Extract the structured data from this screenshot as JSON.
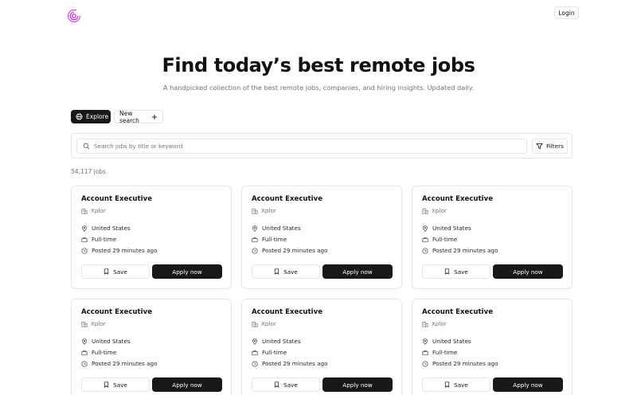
{
  "header": {
    "login_label": "Login"
  },
  "hero": {
    "title": "Find today’s best remote jobs",
    "subtitle": "A handpicked collection of the best remote jobs, companies, and hiring insights. Updated daily."
  },
  "tabs": {
    "explore_label": "Explore",
    "new_search_label": "New search"
  },
  "search": {
    "placeholder": "Search jobs by title or keyword",
    "filters_label": "Filters"
  },
  "results": {
    "count_text": "54,117 jobs"
  },
  "jobs": [
    {
      "title": "Account Executive",
      "company": "Xplor",
      "location": "United States",
      "type": "Full-time",
      "posted": "Posted 29 minutes ago",
      "save_label": "Save",
      "apply_label": "Apply now"
    },
    {
      "title": "Account Executive",
      "company": "Xplor",
      "location": "United States",
      "type": "Full-time",
      "posted": "Posted 29 minutes ago",
      "save_label": "Save",
      "apply_label": "Apply now"
    },
    {
      "title": "Account Executive",
      "company": "Xplor",
      "location": "United States",
      "type": "Full-time",
      "posted": "Posted 29 minutes ago",
      "save_label": "Save",
      "apply_label": "Apply now"
    },
    {
      "title": "Account Executive",
      "company": "Xplor",
      "location": "United States",
      "type": "Full-time",
      "posted": "Posted 29 minutes ago",
      "save_label": "Save",
      "apply_label": "Apply now"
    },
    {
      "title": "Account Executive",
      "company": "Xplor",
      "location": "United States",
      "type": "Full-time",
      "posted": "Posted 29 minutes ago",
      "save_label": "Save",
      "apply_label": "Apply now"
    },
    {
      "title": "Account Executive",
      "company": "Xplor",
      "location": "United States",
      "type": "Full-time",
      "posted": "Posted 29 minutes ago",
      "save_label": "Save",
      "apply_label": "Apply now"
    }
  ],
  "icons": {
    "logo": "spiral-logo-icon",
    "explore": "globe-icon",
    "new_search": "plus-icon",
    "search": "search-icon",
    "filters": "filter-icon",
    "company": "building-icon",
    "location": "map-pin-icon",
    "type": "briefcase-icon",
    "time": "clock-icon",
    "save": "bookmark-icon"
  },
  "colors": {
    "primary": "#18181b",
    "logo_accent": "#c026d3",
    "border": "#e4e4e7",
    "muted_text": "#71717a"
  }
}
